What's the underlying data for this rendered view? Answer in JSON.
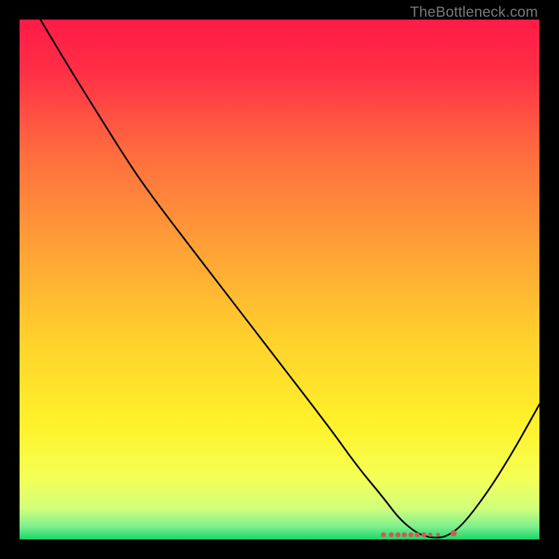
{
  "watermark": "TheBottleneck.com",
  "chart_data": {
    "type": "line",
    "title": "",
    "xlabel": "",
    "ylabel": "",
    "xlim": [
      0,
      100
    ],
    "ylim": [
      0,
      100
    ],
    "series": [
      {
        "name": "curve",
        "x": [
          4,
          10,
          15,
          20,
          24,
          30,
          40,
          50,
          60,
          65,
          70,
          73,
          76,
          78,
          80,
          82,
          85,
          90,
          95,
          100
        ],
        "y": [
          100,
          90,
          82,
          74,
          68,
          60,
          47,
          34,
          21,
          14,
          8,
          4,
          1.5,
          0.6,
          0.3,
          0.5,
          2.5,
          9,
          17,
          26
        ]
      }
    ],
    "markers": {
      "name": "bottom-cluster",
      "color": "#cf5a55",
      "points": [
        {
          "x": 70.0,
          "y": 0.9,
          "r": 2.6
        },
        {
          "x": 71.5,
          "y": 0.9,
          "r": 2.6
        },
        {
          "x": 72.8,
          "y": 0.9,
          "r": 2.6
        },
        {
          "x": 74.0,
          "y": 0.9,
          "r": 2.6
        },
        {
          "x": 75.3,
          "y": 0.9,
          "r": 2.6
        },
        {
          "x": 76.5,
          "y": 0.9,
          "r": 2.6
        },
        {
          "x": 77.8,
          "y": 0.9,
          "r": 2.6
        },
        {
          "x": 79.0,
          "y": 0.9,
          "r": 2.2
        },
        {
          "x": 80.5,
          "y": 0.9,
          "r": 2.0
        },
        {
          "x": 83.5,
          "y": 1.2,
          "r": 3.2
        }
      ]
    },
    "gradient_stops": [
      {
        "offset": 0.0,
        "color": "#ff1a46"
      },
      {
        "offset": 0.1,
        "color": "#ff2f46"
      },
      {
        "offset": 0.25,
        "color": "#ff6a3f"
      },
      {
        "offset": 0.45,
        "color": "#ffa436"
      },
      {
        "offset": 0.62,
        "color": "#ffd22c"
      },
      {
        "offset": 0.78,
        "color": "#fff22a"
      },
      {
        "offset": 0.88,
        "color": "#f4ff55"
      },
      {
        "offset": 0.94,
        "color": "#d2ff7a"
      },
      {
        "offset": 0.975,
        "color": "#7ef08e"
      },
      {
        "offset": 1.0,
        "color": "#18d86a"
      }
    ]
  }
}
